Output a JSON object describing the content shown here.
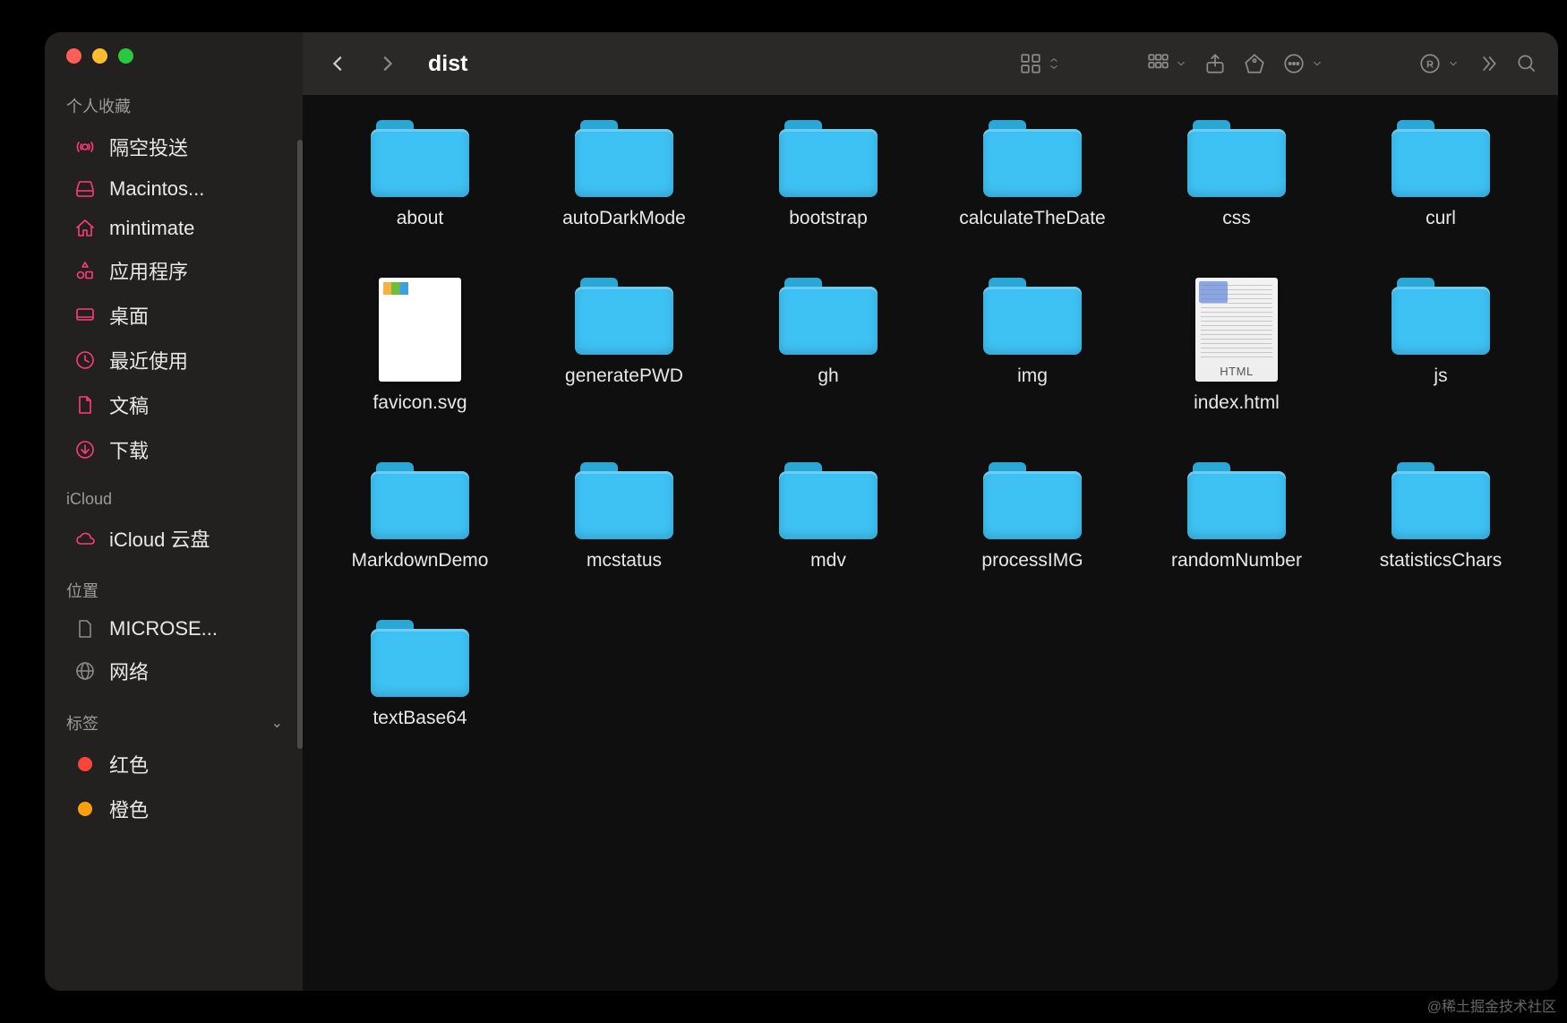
{
  "window": {
    "title": "dist"
  },
  "sidebar": {
    "sections": [
      {
        "key": "favorites",
        "label": "个人收藏",
        "items": [
          {
            "icon": "airdrop",
            "label": "隔空投送"
          },
          {
            "icon": "disk",
            "label": "Macintos..."
          },
          {
            "icon": "home",
            "label": "mintimate"
          },
          {
            "icon": "apps",
            "label": "应用程序"
          },
          {
            "icon": "desktop",
            "label": "桌面"
          },
          {
            "icon": "recent",
            "label": "最近使用"
          },
          {
            "icon": "doc",
            "label": "文稿"
          },
          {
            "icon": "download",
            "label": "下载"
          }
        ]
      },
      {
        "key": "icloud",
        "label": "iCloud",
        "items": [
          {
            "icon": "cloud",
            "label": "iCloud 云盘"
          }
        ]
      },
      {
        "key": "locations",
        "label": "位置",
        "items": [
          {
            "icon": "page",
            "label": "MICROSE..."
          },
          {
            "icon": "globe",
            "label": "网络"
          }
        ]
      },
      {
        "key": "tags",
        "label": "标签",
        "collapsible": true,
        "items": [
          {
            "icon": "tag",
            "color": "#ff453a",
            "label": "红色"
          },
          {
            "icon": "tag",
            "color": "#ff9f0a",
            "label": "橙色"
          }
        ]
      }
    ]
  },
  "files": [
    {
      "name": "about",
      "type": "folder"
    },
    {
      "name": "autoDarkMode",
      "type": "folder"
    },
    {
      "name": "bootstrap",
      "type": "folder"
    },
    {
      "name": "calculateTheDate",
      "type": "folder"
    },
    {
      "name": "css",
      "type": "folder"
    },
    {
      "name": "curl",
      "type": "folder"
    },
    {
      "name": "favicon.svg",
      "type": "svg"
    },
    {
      "name": "generatePWD",
      "type": "folder"
    },
    {
      "name": "gh",
      "type": "folder"
    },
    {
      "name": "img",
      "type": "folder"
    },
    {
      "name": "index.html",
      "type": "html"
    },
    {
      "name": "js",
      "type": "folder"
    },
    {
      "name": "MarkdownDemo",
      "type": "folder"
    },
    {
      "name": "mcstatus",
      "type": "folder"
    },
    {
      "name": "mdv",
      "type": "folder"
    },
    {
      "name": "processIMG",
      "type": "folder"
    },
    {
      "name": "randomNumber",
      "type": "folder"
    },
    {
      "name": "statisticsChars",
      "type": "folder"
    },
    {
      "name": "textBase64",
      "type": "folder"
    }
  ],
  "html_badge": "HTML",
  "watermark": "@稀土掘金技术社区"
}
